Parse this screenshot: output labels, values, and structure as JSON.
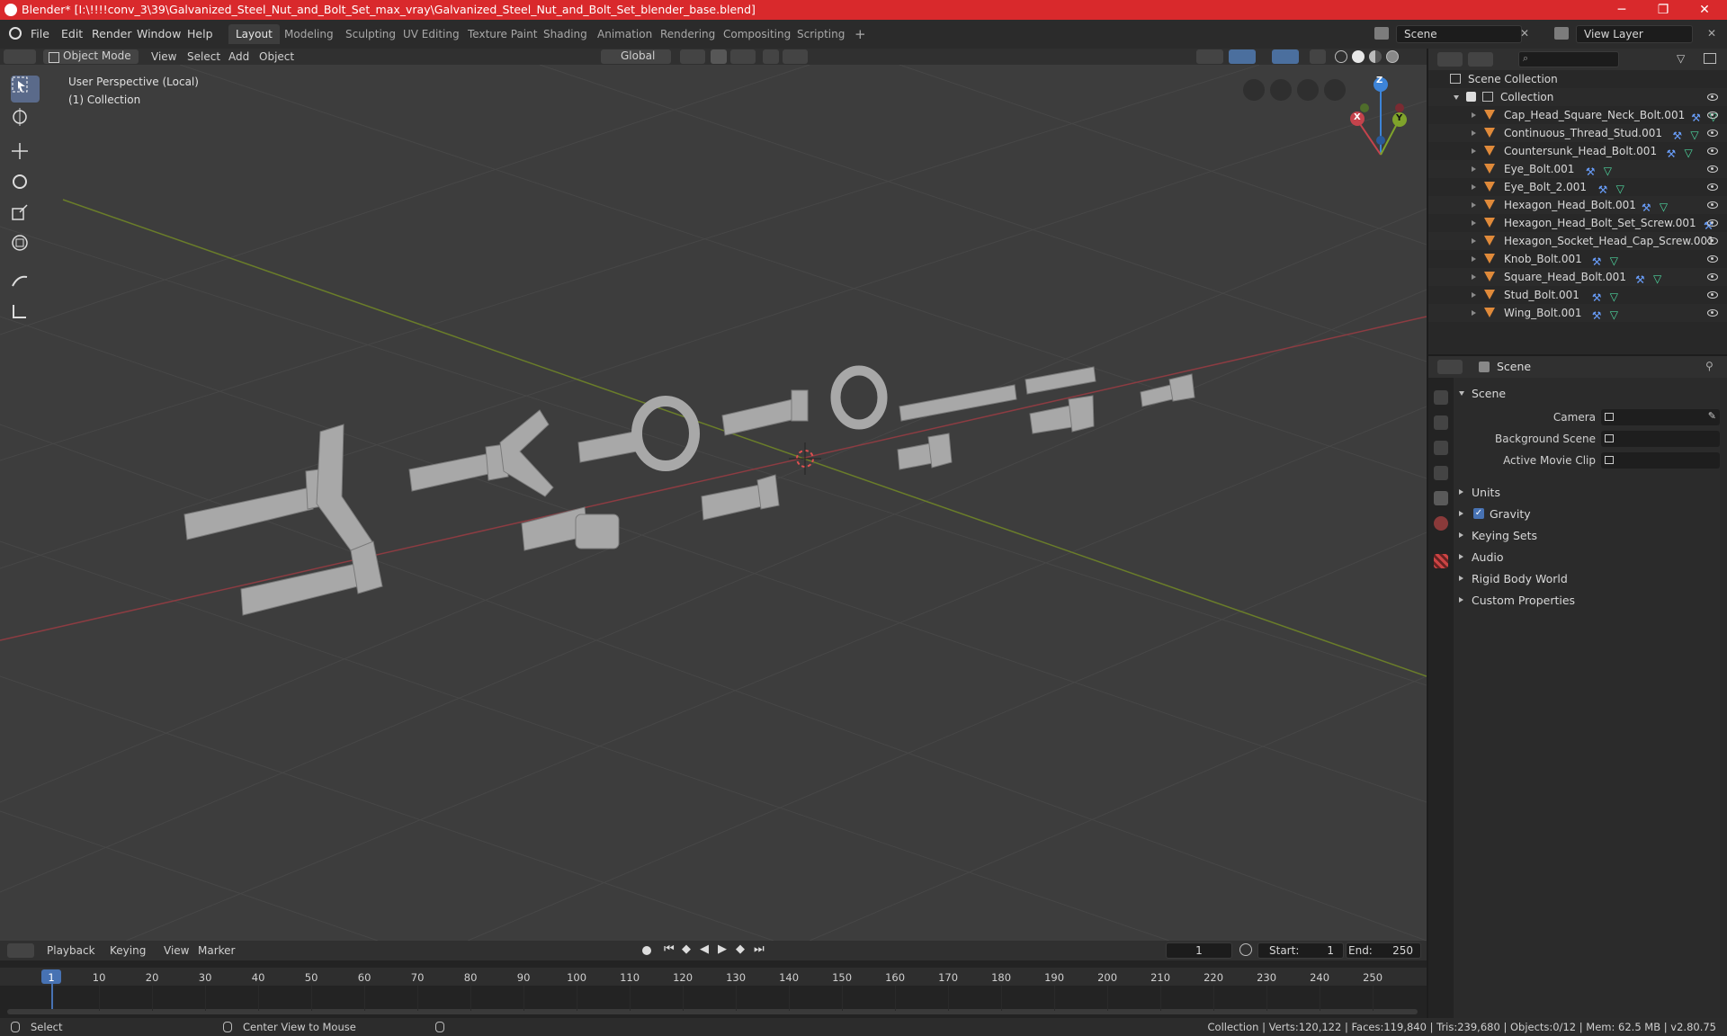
{
  "window": {
    "title": "Blender* [I:\\!!!!conv_3\\39\\Galvanized_Steel_Nut_and_Bolt_Set_max_vray\\Galvanized_Steel_Nut_and_Bolt_Set_blender_base.blend]",
    "minimize": "─",
    "maximize": "❐",
    "close": "✕"
  },
  "menu": {
    "items": [
      "File",
      "Edit",
      "Render",
      "Window",
      "Help"
    ],
    "workspaces": [
      "Layout",
      "Modeling",
      "Sculpting",
      "UV Editing",
      "Texture Paint",
      "Shading",
      "Animation",
      "Rendering",
      "Compositing",
      "Scripting"
    ],
    "add_tab": "+",
    "scene": "Scene",
    "view_layer": "View Layer"
  },
  "viewport_header": {
    "mode": "Object Mode",
    "menus": [
      "View",
      "Select",
      "Add",
      "Object"
    ],
    "orientation": "Global"
  },
  "viewport": {
    "perspective": "User Perspective (Local)",
    "collection": "(1) Collection",
    "gizmo": {
      "x": "X",
      "y": "Y",
      "z": "Z"
    },
    "colors": {
      "x_axis": "#c4434c",
      "y_axis": "#7fa32b",
      "z_axis": "#3d84d8",
      "bg": "#3d3d3d"
    }
  },
  "outliner": {
    "root": "Scene Collection",
    "collection": "Collection",
    "objects": [
      {
        "name": "Cap_Head_Square_Neck_Bolt.001",
        "modifier": true,
        "mesh": true
      },
      {
        "name": "Continuous_Thread_Stud.001",
        "modifier": true,
        "mesh": true
      },
      {
        "name": "Countersunk_Head_Bolt.001",
        "modifier": true,
        "mesh": true
      },
      {
        "name": "Eye_Bolt.001",
        "modifier": true,
        "mesh": true
      },
      {
        "name": "Eye_Bolt_2.001",
        "modifier": true,
        "mesh": true
      },
      {
        "name": "Hexagon_Head_Bolt.001",
        "modifier": true,
        "mesh": true
      },
      {
        "name": "Hexagon_Head_Bolt_Set_Screw.001",
        "modifier": true,
        "mesh": false
      },
      {
        "name": "Hexagon_Socket_Head_Cap_Screw.001",
        "modifier": false,
        "mesh": false
      },
      {
        "name": "Knob_Bolt.001",
        "modifier": true,
        "mesh": true
      },
      {
        "name": "Square_Head_Bolt.001",
        "modifier": true,
        "mesh": true
      },
      {
        "name": "Stud_Bolt.001",
        "modifier": true,
        "mesh": true
      },
      {
        "name": "Wing_Bolt.001",
        "modifier": true,
        "mesh": true
      }
    ]
  },
  "properties": {
    "context": "Scene",
    "panel": "Scene",
    "fields": [
      {
        "label": "Camera"
      },
      {
        "label": "Background Scene"
      },
      {
        "label": "Active Movie Clip"
      }
    ],
    "sections": [
      "Units",
      "Gravity",
      "Keying Sets",
      "Audio",
      "Rigid Body World",
      "Custom Properties"
    ],
    "gravity_checked": true
  },
  "timeline": {
    "menus": [
      "Playback",
      "Keying",
      "View",
      "Marker"
    ],
    "current_frame": "1",
    "start_label": "Start:",
    "start": "1",
    "end_label": "End:",
    "end": "250",
    "ticks": [
      "1",
      "10",
      "20",
      "30",
      "40",
      "50",
      "60",
      "70",
      "80",
      "90",
      "100",
      "110",
      "120",
      "130",
      "140",
      "150",
      "160",
      "170",
      "180",
      "190",
      "200",
      "210",
      "220",
      "230",
      "240",
      "250"
    ]
  },
  "status": {
    "select": "Select",
    "center_view": "Center View to Mouse",
    "stats": "Collection | Verts:120,122 | Faces:119,840 | Tris:239,680 | Objects:0/12 | Mem: 62.5 MB | v2.80.75"
  }
}
